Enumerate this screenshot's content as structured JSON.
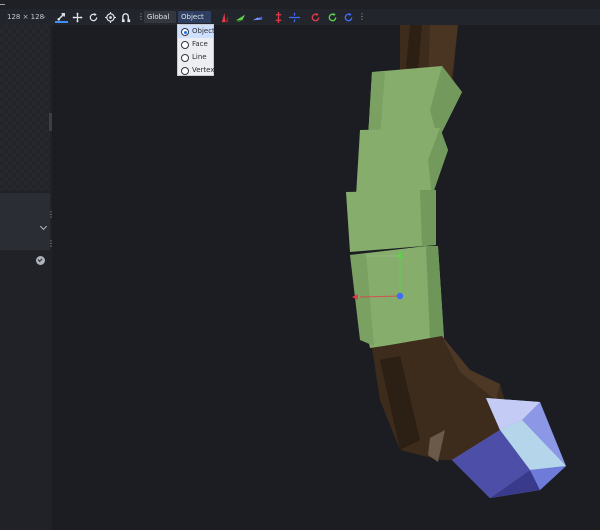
{
  "sidebar": {
    "resolution_label": "128 × 128"
  },
  "toolbar": {
    "transform_space": "Global",
    "selection_mode": "Object",
    "tools": [
      "move-tool-icon",
      "translate-icon",
      "rotate-icon",
      "pivot-icon",
      "vertex-snap-icon"
    ],
    "axis_tools": [
      "mirror-x-icon",
      "mirror-y-icon",
      "mirror-z-icon",
      "center-x-icon",
      "center-y-icon",
      "rotate-x-icon",
      "rotate-y-icon",
      "rotate-z-icon"
    ]
  },
  "dropdown": {
    "options": [
      {
        "label": "Object",
        "selected": true
      },
      {
        "label": "Face",
        "selected": false
      },
      {
        "label": "Line",
        "selected": false
      },
      {
        "label": "Vertex",
        "selected": false
      }
    ]
  },
  "colors": {
    "accent": "#3e90ff",
    "model_green": "#86ad6c",
    "model_brown": "#3d2b1c",
    "gem_blue": "#8c97e6",
    "gizmo_x": "#e23b4b",
    "gizmo_y": "#59d24a",
    "gizmo_z": "#3f6bff"
  }
}
